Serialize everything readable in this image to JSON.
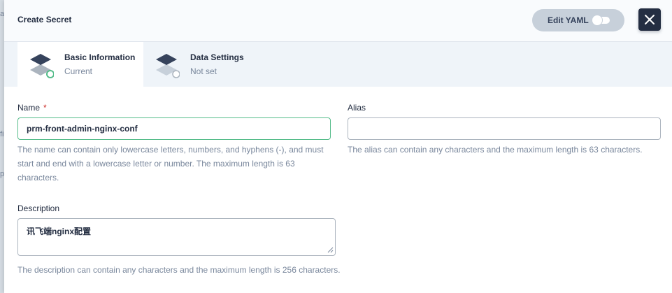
{
  "background": {
    "fragments": [
      "a",
      "fi",
      "p"
    ]
  },
  "header": {
    "title": "Create Secret",
    "edit_yaml_label": "Edit YAML",
    "close_icon": "close-icon"
  },
  "steps": [
    {
      "name": "Basic Information",
      "status": "Current",
      "icon": "layers-icon",
      "state": "active"
    },
    {
      "name": "Data Settings",
      "status": "Not set",
      "icon": "layers-icon",
      "state": "pending"
    }
  ],
  "form": {
    "name": {
      "label": "Name",
      "required_mark": "*",
      "value": "prm-front-admin-nginx-conf",
      "help": "The name can contain only lowercase letters, numbers, and hyphens (-), and must start and end with a lowercase letter or number. The maximum length is 63 characters."
    },
    "alias": {
      "label": "Alias",
      "value": "",
      "help": "The alias can contain any characters and the maximum length is 63 characters."
    },
    "description": {
      "label": "Description",
      "value": "讯飞端nginx配置",
      "help": "The description can contain any characters and the maximum length is 256 characters."
    }
  },
  "colors": {
    "accent_green": "#55bc8a",
    "dark": "#242e42",
    "muted": "#79879c",
    "required": "#ca2621"
  }
}
